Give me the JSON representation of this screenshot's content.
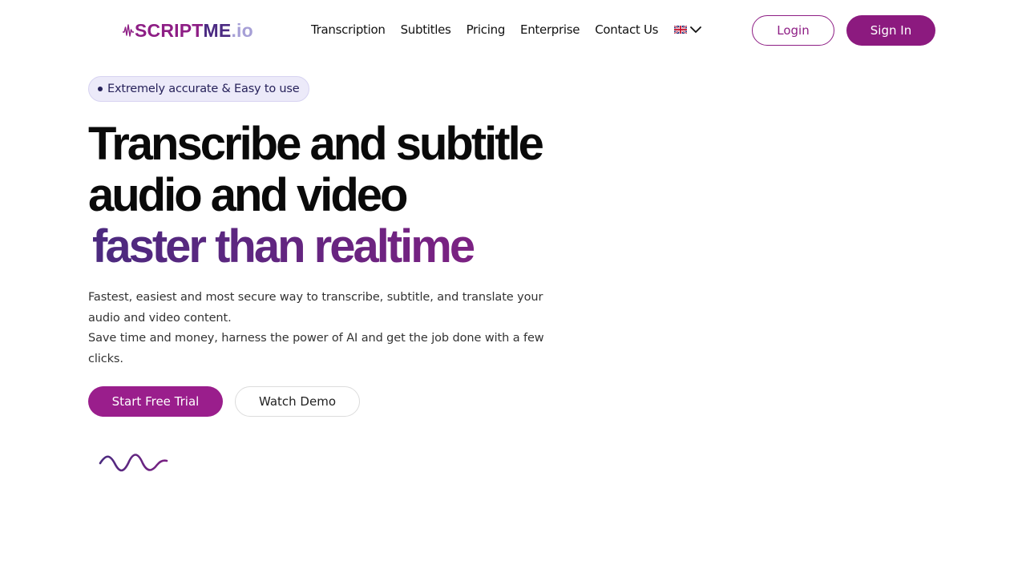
{
  "header": {
    "logo": {
      "part1": "SCRIPT",
      "part2": "ME",
      "part3": ".io"
    },
    "nav": [
      "Transcription",
      "Subtitles",
      "Pricing",
      "Enterprise",
      "Contact Us"
    ],
    "language": {
      "flag_icon": "uk-flag-icon",
      "chevron_icon": "chevron-down-icon"
    },
    "login_label": "Login",
    "signin_label": "Sign In"
  },
  "hero": {
    "badge": "Extremely accurate & Easy to use",
    "title_line1": "Transcribe and subtitle",
    "title_line2": "audio and video",
    "title_accent": "faster than realtime",
    "desc_line1": "Fastest, easiest and most secure way to transcribe, subtitle, and translate your audio and video content.",
    "desc_line2": "Save time and money, harness the power of AI and get the job done with a few clicks.",
    "cta_primary": "Start Free Trial",
    "cta_secondary": "Watch Demo"
  },
  "colors": {
    "brand": "#8e1e85",
    "brand_dark": "#4b2a82",
    "brand_light": "#a69fd6",
    "badge_bg": "#eceaf9"
  },
  "icons": {
    "logo_wave": "audio-wave-icon",
    "hero_wave": "sound-wave-icon"
  }
}
